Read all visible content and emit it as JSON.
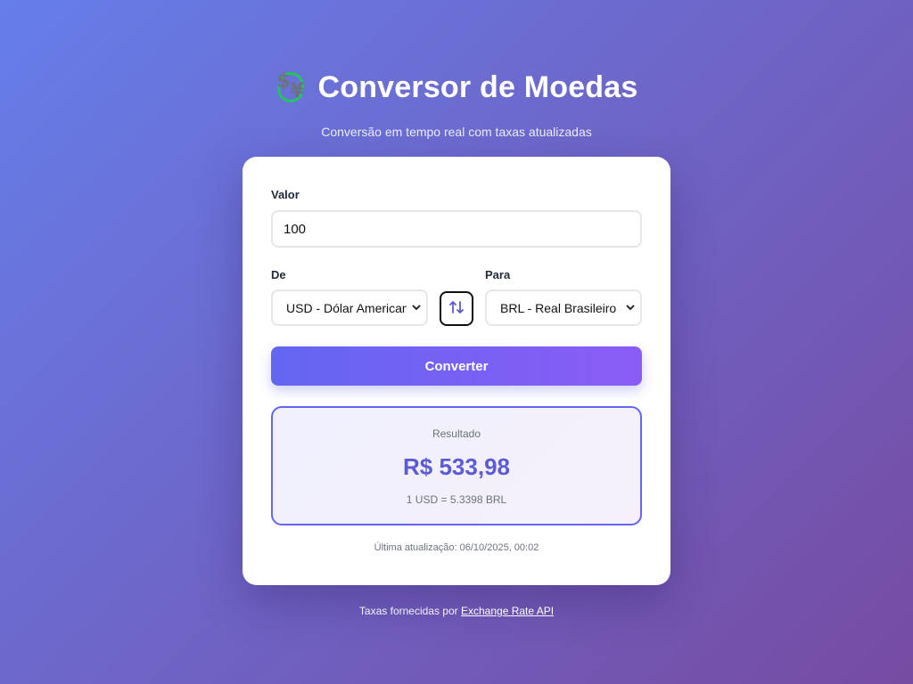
{
  "header": {
    "icon": "currency-exchange-icon",
    "title": "Conversor de Moedas",
    "subtitle": "Conversão em tempo real com taxas atualizadas"
  },
  "form": {
    "amount_label": "Valor",
    "amount_value": "100",
    "from_label": "De",
    "from_selected": "USD - Dólar Americano",
    "to_label": "Para",
    "to_selected": "BRL - Real Brasileiro",
    "swap_icon": "swap-arrows-icon",
    "convert_label": "Converter"
  },
  "result": {
    "label": "Resultado",
    "value": "R$ 533,98",
    "rate": "1 USD = 5.3398 BRL"
  },
  "last_update": "Última atualização: 06/10/2025, 00:02",
  "footer": {
    "prefix": "Taxas fornecidas por",
    "link_text": "Exchange Rate API"
  },
  "colors": {
    "background_start": "#667eea",
    "background_end": "#764ba2",
    "accent": "#6366f1",
    "accent_end": "#8b5cf6"
  }
}
